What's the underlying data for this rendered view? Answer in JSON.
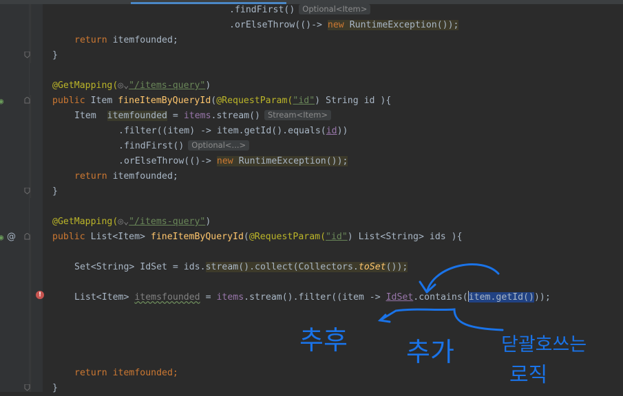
{
  "editor": {
    "lines": [
      {
        "id": "l0",
        "tokens": [
          ".findFirst()"
        ],
        "hint": "Optional<Item>"
      },
      {
        "id": "l1",
        "tokens": [
          ".orElseThrow(()-> ",
          "new",
          " RuntimeException());"
        ]
      },
      {
        "id": "l2",
        "tokens": [
          "return",
          " itemfounded;"
        ]
      },
      {
        "id": "l3",
        "tokens": [
          "}"
        ]
      },
      {
        "id": "l4",
        "tokens": [
          "@GetMapping(",
          "\"/items-query\"",
          ")"
        ]
      },
      {
        "id": "l5",
        "tokens": [
          "public",
          " Item ",
          "fineItemByQueryId",
          "(",
          "@RequestParam(",
          "\"id\"",
          ") String id ){"
        ]
      },
      {
        "id": "l6",
        "tokens": [
          "Item  ",
          "itemfounded",
          " = ",
          "items",
          ".stream()"
        ],
        "hint": "Stream<Item>"
      },
      {
        "id": "l7",
        "tokens": [
          ".filter((item) -> item.getId().equals(",
          "id",
          "))"
        ]
      },
      {
        "id": "l8",
        "tokens": [
          ".findFirst()"
        ],
        "hint": "Optional<...>"
      },
      {
        "id": "l9",
        "tokens": [
          ".orElseThrow(()-> ",
          "new",
          " RuntimeException());"
        ]
      },
      {
        "id": "l10",
        "tokens": [
          "return",
          " itemfounded;"
        ]
      },
      {
        "id": "l11",
        "tokens": [
          "}"
        ]
      },
      {
        "id": "l12",
        "tokens": [
          "@GetMapping(",
          "\"/items-query\"",
          ")"
        ]
      },
      {
        "id": "l13",
        "tokens": [
          "public",
          " List<Item> ",
          "fineItemByQueryId",
          "(",
          "@RequestParam(",
          "\"id\"",
          ") List<String> ids ){"
        ]
      },
      {
        "id": "l14",
        "tokens": [
          "Set<String> IdSet = ids.",
          "stream().collect(Collectors.",
          "toSet",
          "());"
        ]
      },
      {
        "id": "l15",
        "tokens": [
          "List<Item> ",
          "itemsfounded",
          " = ",
          "items",
          ".stream().filter((item -> ",
          "IdSet",
          ".contains(",
          "item.getId()",
          "));"
        ]
      },
      {
        "id": "l16",
        "tokens": [
          "return",
          " itemfounded;"
        ]
      },
      {
        "id": "l17",
        "tokens": [
          "}"
        ]
      }
    ]
  },
  "gutter": {
    "endpoint_icons": [
      "globe-arrow-icon",
      "globe-arrow-icon"
    ],
    "at_marker": "@",
    "error_marker": "!"
  },
  "handwriting": {
    "note_left": "추후",
    "note_middle": "추가",
    "note_right_1": "닫괄호쓰는",
    "note_right_2": "로직"
  },
  "colors": {
    "background": "#2b2b2b",
    "keyword": "#cc7832",
    "annotation": "#bbb529",
    "string": "#6a8759",
    "method": "#ffc66d",
    "field": "#9876aa",
    "text": "#a9b7c6",
    "pen": "#1a73e8"
  }
}
